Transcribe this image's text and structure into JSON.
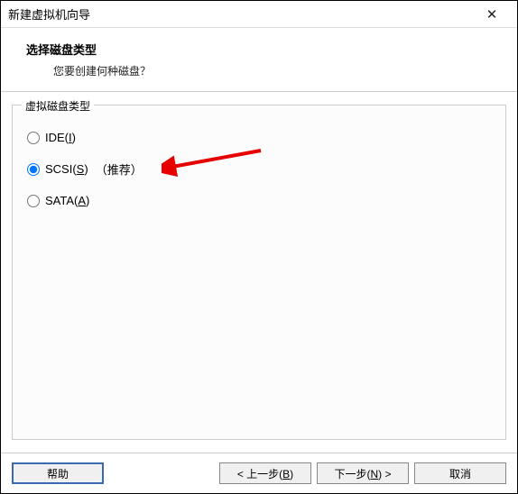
{
  "window": {
    "title": "新建虚拟机向导",
    "close_glyph": "✕"
  },
  "header": {
    "title": "选择磁盘类型",
    "subtitle": "您要创建何种磁盘？"
  },
  "group": {
    "title": "虚拟磁盘类型",
    "options": {
      "ide": {
        "prefix": "IDE(",
        "accel": "I",
        "suffix": ")"
      },
      "scsi": {
        "prefix": "SCSI(",
        "accel": "S",
        "suffix": ")",
        "recommend": "（推荐）",
        "selected": true
      },
      "sata": {
        "prefix": "SATA(",
        "accel": "A",
        "suffix": ")"
      }
    }
  },
  "footer": {
    "help": "帮助",
    "back": {
      "prefix": "< 上一步(",
      "accel": "B",
      "suffix": ")"
    },
    "next": {
      "prefix": "下一步(",
      "accel": "N",
      "suffix": ") >"
    },
    "cancel": "取消"
  },
  "annotation": {
    "arrow_color": "#e60000"
  }
}
